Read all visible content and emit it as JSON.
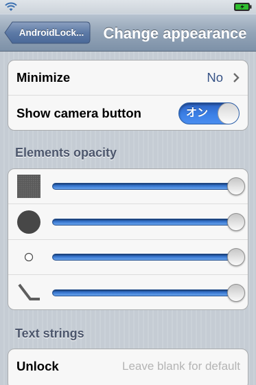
{
  "status_bar": {
    "wifi_icon": "wifi-icon",
    "battery_icon": "battery-charging-icon",
    "battery_color": "#2fbf2f"
  },
  "nav": {
    "back_label": "AndroidLock...",
    "title": "Change appearance"
  },
  "general": {
    "minimize_label": "Minimize",
    "minimize_value": "No",
    "camera_label": "Show camera button",
    "camera_switch_text": "オン",
    "camera_switch_on": true,
    "accent_color": "#3a7ee6"
  },
  "opacity_section": {
    "header": "Elements opacity",
    "sliders": [
      {
        "icon": "square-icon",
        "value": 1.0
      },
      {
        "icon": "large-dot-icon",
        "value": 1.0
      },
      {
        "icon": "small-dot-icon",
        "value": 1.0
      },
      {
        "icon": "line-icon",
        "value": 1.0
      }
    ]
  },
  "text_section": {
    "header": "Text strings",
    "unlock_label": "Unlock",
    "unlock_value": "",
    "unlock_placeholder": "Leave blank for default"
  }
}
